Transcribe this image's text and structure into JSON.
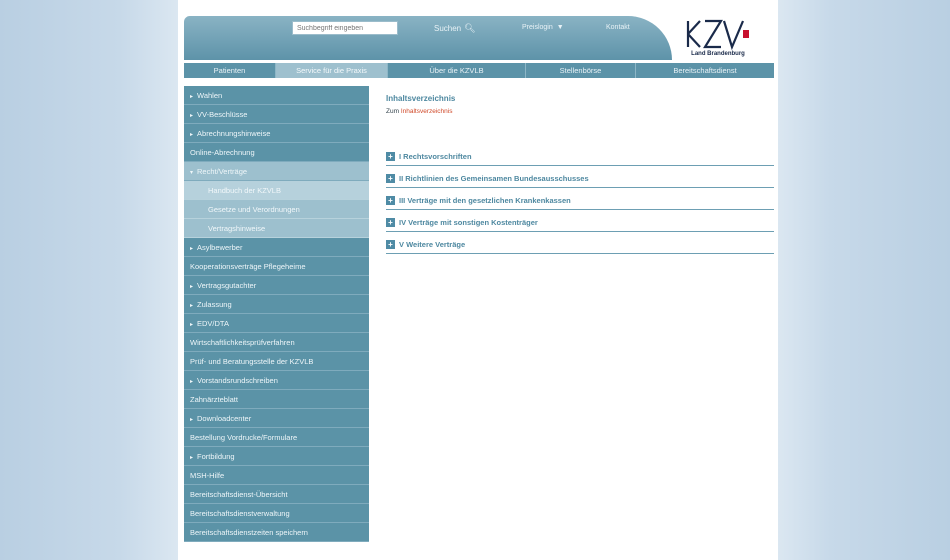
{
  "header": {
    "search_placeholder": "Suchbegriff eingeben",
    "search_button": "Suchen",
    "preislogin": "Preislogin",
    "kontakt": "Kontakt",
    "logo_text": "KZV",
    "logo_sub": "Land Brandenburg"
  },
  "nav": {
    "items": [
      {
        "label": "Patienten"
      },
      {
        "label": "Service für die Praxis"
      },
      {
        "label": "Über die KZVLB"
      },
      {
        "label": "Stellenbörse"
      },
      {
        "label": "Bereitschaftsdienst"
      }
    ]
  },
  "sidebar": {
    "items": [
      {
        "label": "Wahlen"
      },
      {
        "label": "VV-Beschlüsse"
      },
      {
        "label": "Abrechnungshinweise"
      },
      {
        "label": "Online-Abrechnung"
      },
      {
        "label": "Recht/Verträge"
      },
      {
        "label": "Handbuch der KZVLB"
      },
      {
        "label": "Gesetze und Verordnungen"
      },
      {
        "label": "Vertragshinweise"
      },
      {
        "label": "Asylbewerber"
      },
      {
        "label": "Kooperationsverträge Pflegeheime"
      },
      {
        "label": "Vertragsgutachter"
      },
      {
        "label": "Zulassung"
      },
      {
        "label": "EDV/DTA"
      },
      {
        "label": "Wirtschaftlichkeitsprüfverfahren"
      },
      {
        "label": "Prüf- und Beratungsstelle der KZVLB"
      },
      {
        "label": "Vorstandsrundschreiben"
      },
      {
        "label": "Zahnärzteblatt"
      },
      {
        "label": "Downloadcenter"
      },
      {
        "label": "Bestellung Vordrucke/Formulare"
      },
      {
        "label": "Fortbildung"
      },
      {
        "label": "MSH-Hilfe"
      },
      {
        "label": "Bereitschaftsdienst-Übersicht"
      },
      {
        "label": "Bereitschaftsdienstverwaltung"
      },
      {
        "label": "Bereitschaftsdienstzeiten speichern"
      }
    ]
  },
  "main": {
    "toc_title": "Inhaltsverzeichnis",
    "toc_prefix": "Zum",
    "toc_link": "Inhaltsverzeichnis",
    "sections": [
      {
        "label": "I Rechtsvorschriften"
      },
      {
        "label": "II Richtlinien des Gemeinsamen Bundesausschusses"
      },
      {
        "label": "III Verträge mit den gesetzlichen Krankenkassen"
      },
      {
        "label": "IV Verträge mit sonstigen Kostenträger"
      },
      {
        "label": "V Weitere Verträge"
      }
    ]
  },
  "colors": {
    "primary": "#5b93a7",
    "secondary": "#9dc0ce",
    "link": "#d04a2a",
    "heading": "#4e88a0"
  }
}
